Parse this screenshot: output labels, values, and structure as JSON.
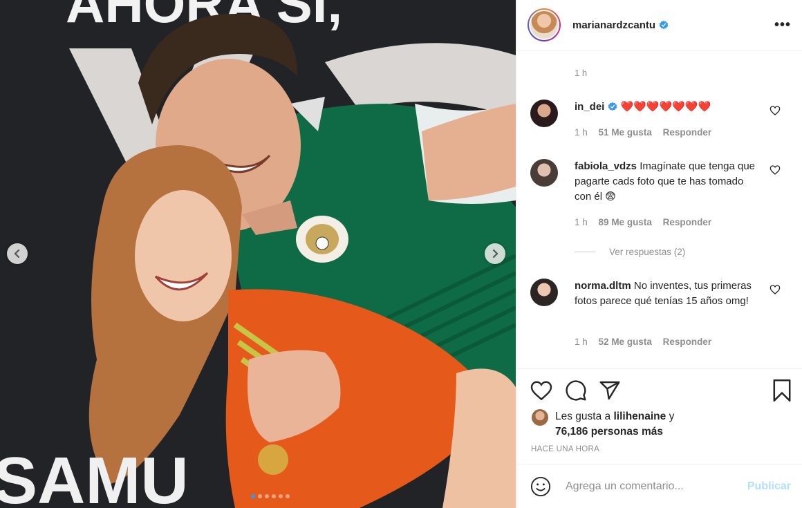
{
  "photo": {
    "banner_text": "AHORA SÍ,",
    "bottom_text": "SAMU",
    "carousel_dots": 6,
    "active_dot": 0
  },
  "post": {
    "username": "marianardzcantu",
    "verified": true
  },
  "caption_time": "1 h",
  "comments": [
    {
      "username": "in_dei",
      "verified": true,
      "text": "❤️❤️❤️❤️❤️❤️❤️",
      "time": "1 h",
      "likes": "51 Me gusta",
      "reply": "Responder",
      "avatar_color": "#3a2428"
    },
    {
      "username": "fabiola_vdzs",
      "verified": false,
      "text": "Imagínate que tenga que pagarte cads foto que te has tomado con él 😨",
      "time": "1 h",
      "likes": "89 Me gusta",
      "reply": "Responder",
      "avatar_color": "#5a4a42"
    },
    {
      "username": "norma.dltm",
      "verified": false,
      "text": "No inventes, tus primeras fotos parece qué tenías 15 años omg!",
      "time": "1 h",
      "likes": "52 Me gusta",
      "reply": "Responder",
      "avatar_color": "#3b3030"
    }
  ],
  "view_replies": "Ver respuestas (2)",
  "liked_by": {
    "prefix": "Les gusta a",
    "user": "lilihenaine",
    "joiner": "y",
    "others": "76,186 personas más"
  },
  "time_ago": "HACE UNA HORA",
  "comment_box": {
    "placeholder": "Agrega un comentario...",
    "publish": "Publicar"
  },
  "colors": {
    "verified": "#3897f0",
    "heart_red": "#ed4956",
    "publish_disabled": "#b2dffc",
    "muted": "#8e8e8e"
  }
}
